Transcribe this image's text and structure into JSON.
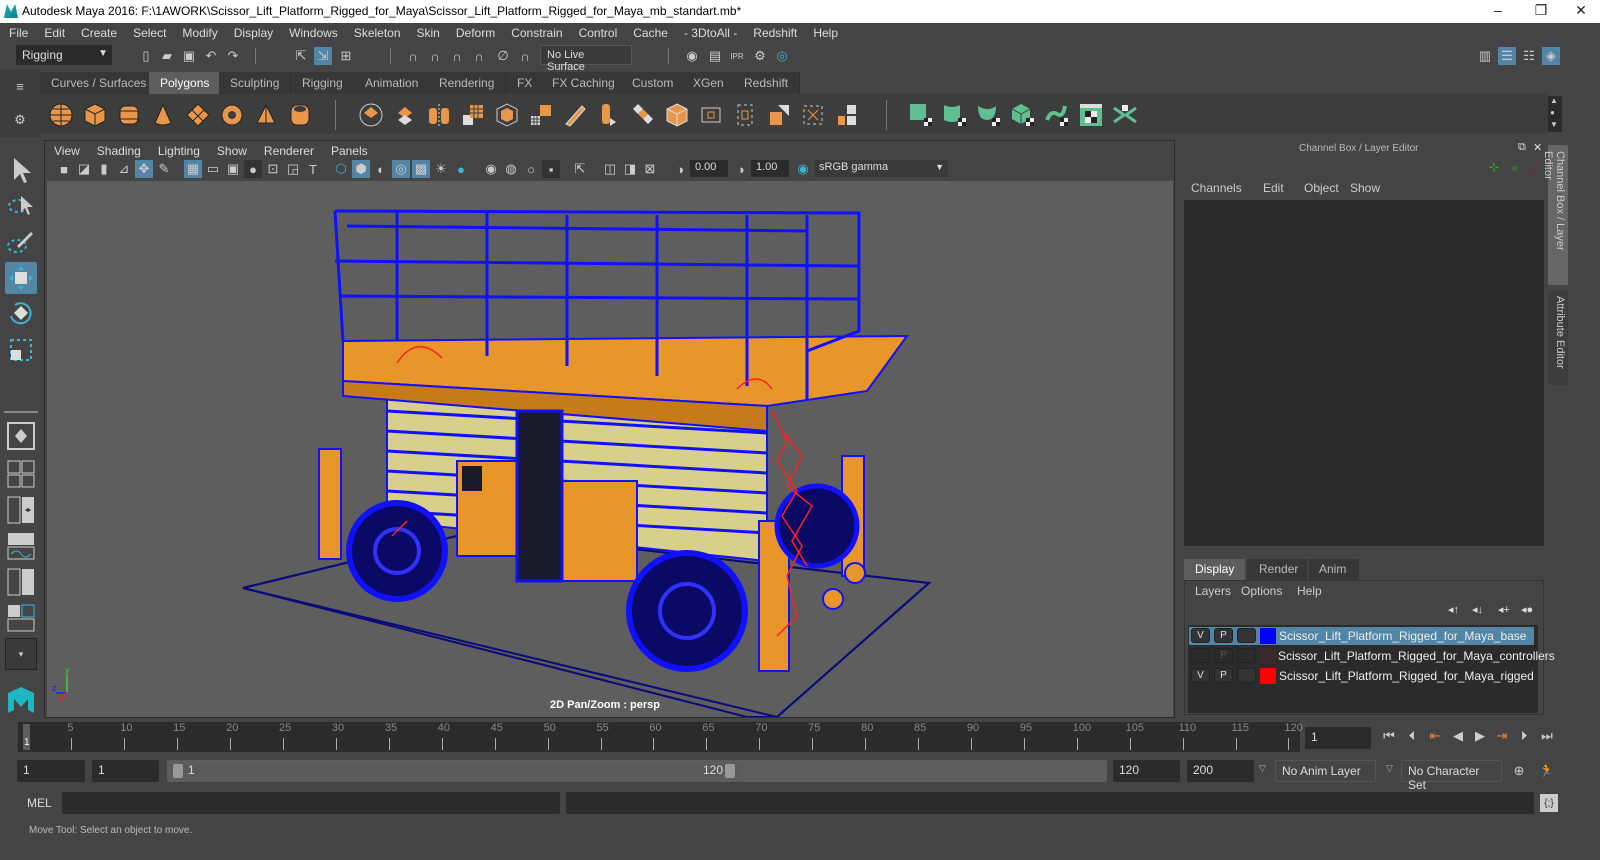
{
  "window": {
    "title": "Autodesk Maya 2016: F:\\1AWORK\\Scissor_Lift_Platform_Rigged_for_Maya\\Scissor_Lift_Platform_Rigged_for_Maya_mb_standart.mb*",
    "minimize": "–",
    "restore": "❐",
    "close": "✕"
  },
  "menubar": [
    "File",
    "Edit",
    "Create",
    "Select",
    "Modify",
    "Display",
    "Windows",
    "Skeleton",
    "Skin",
    "Deform",
    "Constrain",
    "Control",
    "Cache",
    "- 3DtoAll -",
    "Redshift",
    "Help"
  ],
  "statusline": {
    "mode": "Rigging",
    "live_surface": "No Live Surface"
  },
  "shelf_tabs": [
    {
      "label": "Curves / Surfaces",
      "active": false
    },
    {
      "label": "Polygons",
      "active": true
    },
    {
      "label": "Sculpting",
      "active": false
    },
    {
      "label": "Rigging",
      "active": false
    },
    {
      "label": "Animation",
      "active": false
    },
    {
      "label": "Rendering",
      "active": false
    },
    {
      "label": "FX",
      "active": false
    },
    {
      "label": "FX Caching",
      "active": false
    },
    {
      "label": "Custom",
      "active": false
    },
    {
      "label": "XGen",
      "active": false
    },
    {
      "label": "Redshift",
      "active": false
    }
  ],
  "shelf_icons": {
    "primitives": [
      "poly-sphere-icon",
      "poly-cube-icon",
      "poly-cylinder-icon",
      "poly-cone-icon",
      "poly-plane-icon",
      "poly-torus-icon",
      "poly-pyramid-icon",
      "poly-pipe-icon"
    ],
    "tools": [
      "combine-icon",
      "separate-icon",
      "mirror-icon",
      "smooth-icon",
      "extrude-icon",
      "bridge-icon",
      "append-icon",
      "insert-edge-loop-icon",
      "bevel-icon",
      "multi-cut-icon",
      "bevel-box-icon",
      "cylindrical-map-icon",
      "planar-map-icon",
      "spherical-map-icon",
      "automatic-map-icon",
      "layout-uv-icon"
    ],
    "uv": [
      "uv-planar-icon",
      "uv-cylindrical-icon",
      "uv-spherical-icon",
      "uv-auto-icon",
      "uv-contour-icon",
      "uv-editor-icon",
      "uv-unfold-icon"
    ]
  },
  "panel_menu": [
    "View",
    "Shading",
    "Lighting",
    "Show",
    "Renderer",
    "Panels"
  ],
  "panel_toolbar": {
    "exposure": "0.00",
    "gamma": "1.00",
    "color_space": "sRGB gamma"
  },
  "viewport": {
    "label": "2D Pan/Zoom : persp",
    "axis": {
      "x": "x",
      "y": "y",
      "z": "z"
    },
    "colors": {
      "wire": "#1010ff",
      "body": "#e8962a",
      "rig": "#ff2020",
      "ground": "#0a0a7a"
    }
  },
  "channel_box": {
    "title": "Channel Box / Layer Editor",
    "menu": [
      "Channels",
      "Edit",
      "Object",
      "Show"
    ]
  },
  "layer_editor": {
    "tabs": [
      {
        "label": "Display",
        "active": true
      },
      {
        "label": "Render",
        "active": false
      },
      {
        "label": "Anim",
        "active": false
      }
    ],
    "menu": [
      "Layers",
      "Options",
      "Help"
    ],
    "layers": [
      {
        "v": "V",
        "p": "P",
        "name": "Scissor_Lift_Platform_Rigged_for_Maya_base",
        "color": "#0000ff",
        "selected": true
      },
      {
        "v": "",
        "p": "P",
        "name": "Scissor_Lift_Platform_Rigged_for_Maya_controllers",
        "color": "#3a2a2a",
        "selected": false
      },
      {
        "v": "V",
        "p": "P",
        "name": "Scissor_Lift_Platform_Rigged_for_Maya_rigged",
        "color": "#ff0000",
        "selected": false
      }
    ]
  },
  "side_tabs": [
    "Channel Box / Layer Editor",
    "Attribute Editor"
  ],
  "time_slider": {
    "ticks": [
      "5",
      "10",
      "15",
      "20",
      "25",
      "30",
      "35",
      "40",
      "45",
      "50",
      "55",
      "60",
      "65",
      "70",
      "75",
      "80",
      "85",
      "90",
      "95",
      "100",
      "105",
      "110",
      "115",
      "120"
    ],
    "current_frame_marker": "1",
    "current_frame": "1"
  },
  "range_slider": {
    "start": "1",
    "playback_start": "1",
    "range_start_label": "1",
    "range_end_label": "120",
    "playback_end": "120",
    "end": "200",
    "anim_layer": "No Anim Layer",
    "character_set": "No Character Set"
  },
  "command_line": {
    "lang": "MEL"
  },
  "help_line": "Move Tool: Select an object to move."
}
